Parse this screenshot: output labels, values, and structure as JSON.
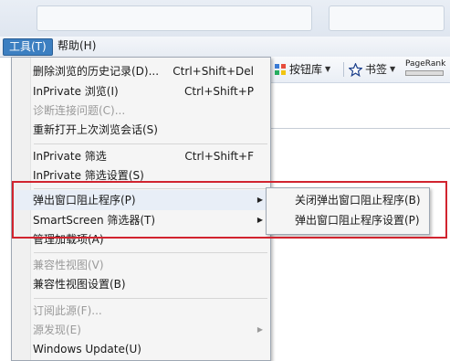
{
  "menubar": {
    "tools": "工具(T)",
    "help": "帮助(H)"
  },
  "toolbar": {
    "buttons_label": "按钮库",
    "favorites_label": "书签",
    "pagerank_label": "PageRank"
  },
  "tools_menu": {
    "items": [
      {
        "label": "删除浏览的历史记录(D)...",
        "shortcut": "Ctrl+Shift+Del"
      },
      {
        "label": "InPrivate 浏览(I)",
        "shortcut": "Ctrl+Shift+P"
      },
      {
        "label": "诊断连接问题(C)..."
      },
      {
        "label": "重新打开上次浏览会话(S)"
      },
      {
        "label": "InPrivate 筛选",
        "shortcut": "Ctrl+Shift+F"
      },
      {
        "label": "InPrivate 筛选设置(S)"
      },
      {
        "label": "弹出窗口阻止程序(P)"
      },
      {
        "label": "SmartScreen 筛选器(T)"
      },
      {
        "label": "管理加载项(A)"
      },
      {
        "label": "兼容性视图(V)"
      },
      {
        "label": "兼容性视图设置(B)"
      },
      {
        "label": "订阅此源(F)..."
      },
      {
        "label": "源发现(E)"
      },
      {
        "label": "Windows Update(U)"
      }
    ]
  },
  "popup_submenu": {
    "items": [
      {
        "label": "关闭弹出窗口阻止程序(B)"
      },
      {
        "label": "弹出窗口阻止程序设置(P)"
      }
    ]
  },
  "colors": {
    "highlight_box": "#d1242f",
    "menu_active": "#3c7fc1"
  }
}
